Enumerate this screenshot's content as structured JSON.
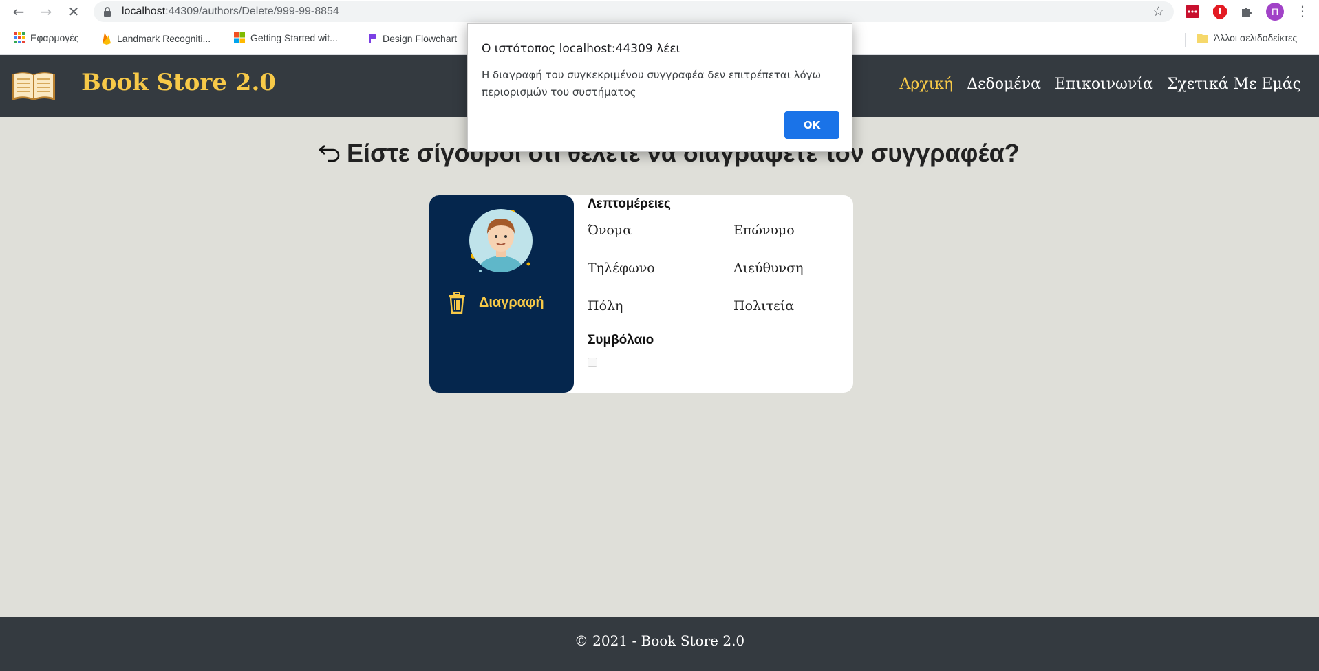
{
  "browser": {
    "url_host": "localhost",
    "url_rest": ":44309/authors/Delete/999-99-8854",
    "profile_initial": "Π",
    "bookmarks": [
      {
        "label": "Εφαρμογές"
      },
      {
        "label": "Landmark Recogniti..."
      },
      {
        "label": "Getting Started wit..."
      },
      {
        "label": "Design Flowchart"
      }
    ],
    "other_bookmarks": "Άλλοι σελιδοδείκτες"
  },
  "header": {
    "brand": "Book Store 2.0",
    "nav": [
      "Αρχική",
      "Δεδομένα",
      "Επικοινωνία",
      "Σχετικά Με Εμάς"
    ]
  },
  "page": {
    "title": "Είστε σίγουροι ότι θέλετε να διαγράψετε τον συγγραφέα?",
    "delete_label": "Διαγραφή",
    "details_title": "Λεπτομέρειες",
    "fields": {
      "first_name": "Όνομα",
      "last_name": "Επώνυμο",
      "phone": "Τηλέφωνο",
      "address": "Διεύθυνση",
      "city": "Πόλη",
      "state": "Πολιτεία"
    },
    "contract_label": "Συμβόλαιο",
    "contract_checked": false
  },
  "footer": {
    "text": "© 2021 - Book Store 2.0"
  },
  "alert": {
    "title": "Ο ιστότοπος localhost:44309 λέει",
    "message": "Η διαγραφή του συγκεκριμένου συγγραφέα δεν επιτρέπεται λόγω περιορισμών του συστήματος",
    "ok_label": "OK"
  },
  "colors": {
    "accent": "#f7c948",
    "navbar": "#343a40",
    "card_side": "#05264d",
    "page_bg": "#dfdfd9",
    "alert_button": "#1a73e8"
  }
}
